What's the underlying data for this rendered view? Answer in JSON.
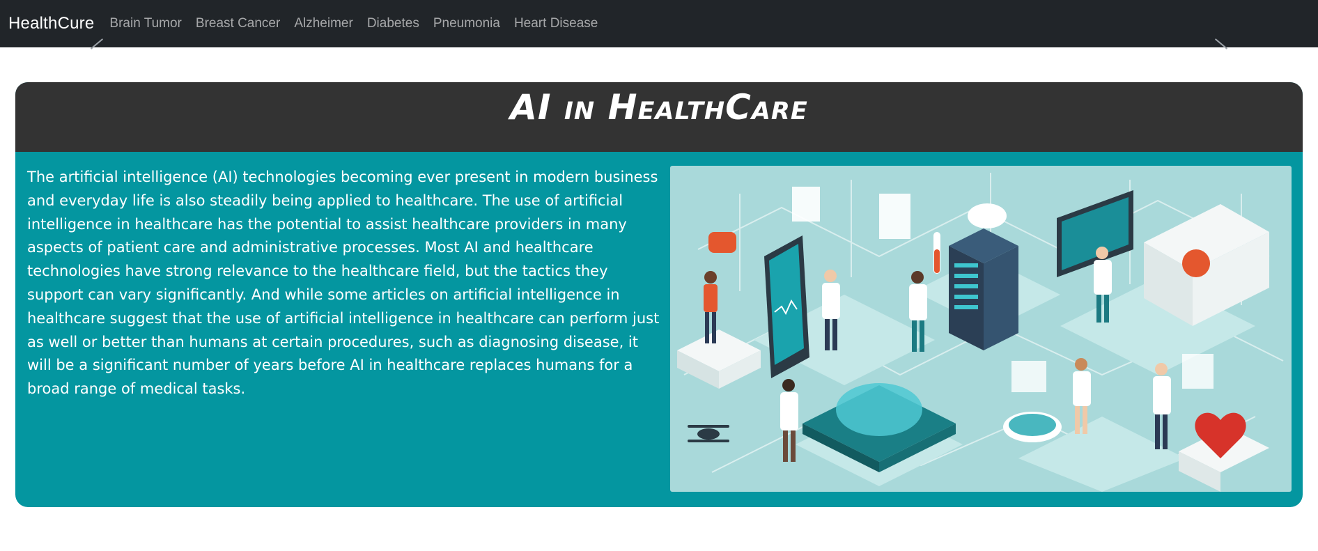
{
  "navbar": {
    "brand": "HealthCure",
    "links": [
      {
        "label": "Brain Tumor"
      },
      {
        "label": "Breast Cancer"
      },
      {
        "label": "Alzheimer"
      },
      {
        "label": "Diabetes"
      },
      {
        "label": "Pneumonia"
      },
      {
        "label": "Heart Disease"
      }
    ]
  },
  "hero": {
    "title": "AI in HealthCare",
    "text": "The artificial intelligence (AI) technologies becoming ever present in modern business and everyday life is also steadily being applied to healthcare. The use of artificial intelligence in healthcare has the potential to assist healthcare providers in many aspects of patient care and administrative processes. Most AI and healthcare technologies have strong relevance to the healthcare field, but the tactics they support can vary significantly. And while some articles on artificial intelligence in healthcare suggest that the use of artificial intelligence in healthcare can perform just as well or better than humans at certain procedures, such as diagnosing disease, it will be a significant number of years before AI in healthcare replaces humans for a broad range of medical tasks."
  },
  "colors": {
    "navbar_bg": "#212529",
    "card_header_bg": "#333333",
    "card_body_bg": "#0496a0",
    "illustration_bg": "#a9d9da"
  }
}
